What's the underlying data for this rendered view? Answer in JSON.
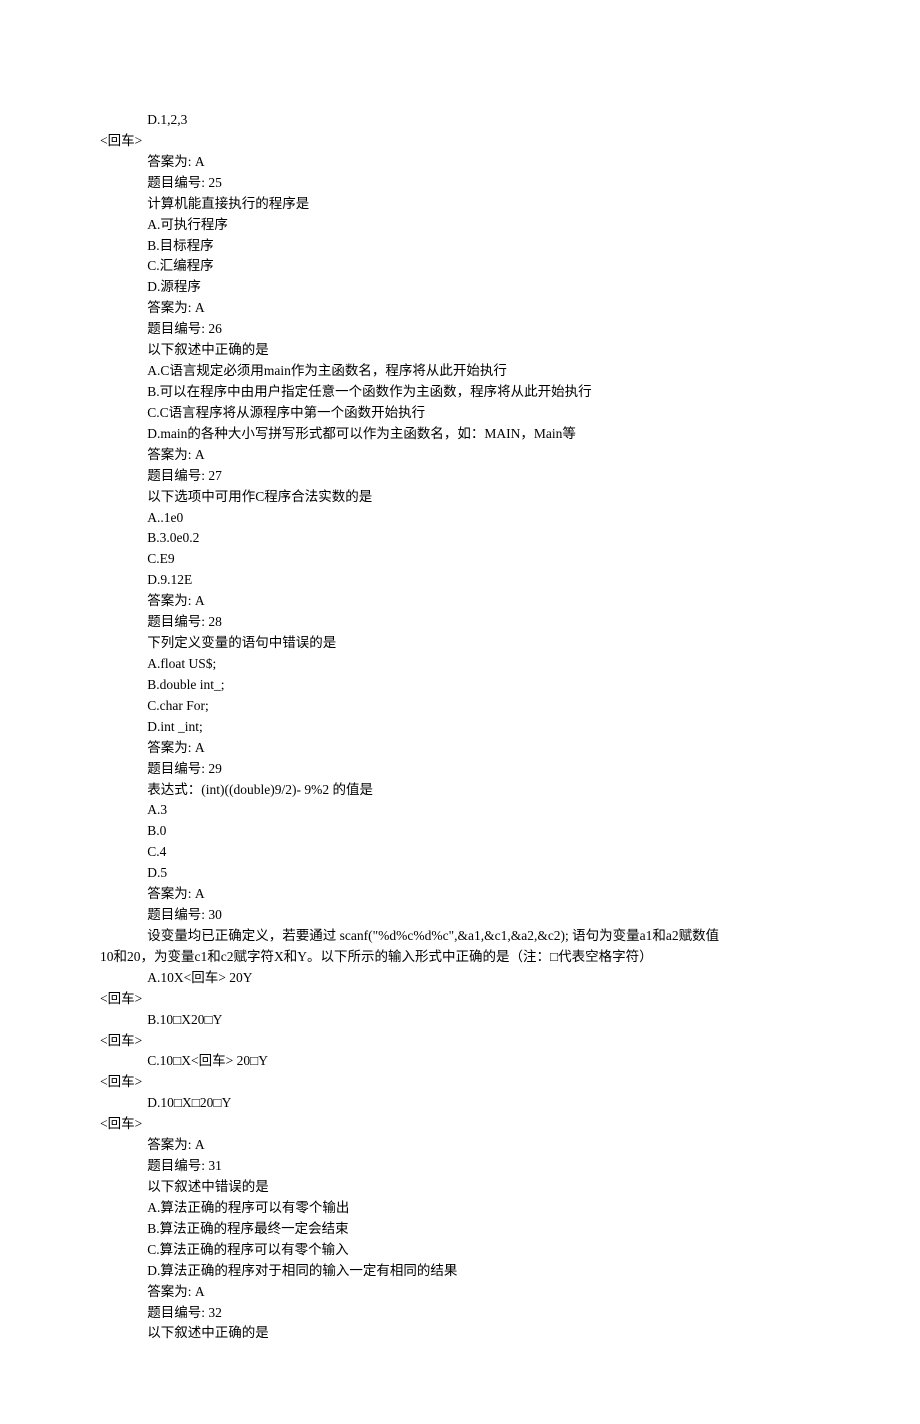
{
  "lines": [
    {
      "cls": "indent1",
      "text": "D.1,2,3"
    },
    {
      "cls": "flush",
      "text": "<回车>"
    },
    {
      "cls": "indent1",
      "text": "答案为: A"
    },
    {
      "cls": "indent1",
      "text": "题目编号: 25"
    },
    {
      "cls": "indent1",
      "text": "计算机能直接执行的程序是"
    },
    {
      "cls": "indent1",
      "text": "A.可执行程序"
    },
    {
      "cls": "indent1",
      "text": "B.目标程序"
    },
    {
      "cls": "indent1",
      "text": "C.汇编程序"
    },
    {
      "cls": "indent1",
      "text": "D.源程序"
    },
    {
      "cls": "indent1",
      "text": "答案为: A"
    },
    {
      "cls": "indent1",
      "text": "题目编号: 26"
    },
    {
      "cls": "indent1",
      "text": "以下叙述中正确的是"
    },
    {
      "cls": "indent1",
      "text": "A.C语言规定必须用main作为主函数名，程序将从此开始执行"
    },
    {
      "cls": "indent1",
      "text": "B.可以在程序中由用户指定任意一个函数作为主函数，程序将从此开始执行"
    },
    {
      "cls": "indent1",
      "text": "C.C语言程序将从源程序中第一个函数开始执行"
    },
    {
      "cls": "indent1",
      "text": "D.main的各种大小写拼写形式都可以作为主函数名，如：MAIN，Main等"
    },
    {
      "cls": "indent1",
      "text": "答案为: A"
    },
    {
      "cls": "indent1",
      "text": "题目编号: 27"
    },
    {
      "cls": "indent1",
      "text": "以下选项中可用作C程序合法实数的是"
    },
    {
      "cls": "indent1",
      "text": "A..1e0"
    },
    {
      "cls": "indent1",
      "text": "B.3.0e0.2"
    },
    {
      "cls": "indent1",
      "text": "C.E9"
    },
    {
      "cls": "indent1",
      "text": "D.9.12E"
    },
    {
      "cls": "indent1",
      "text": "答案为: A"
    },
    {
      "cls": "indent1",
      "text": "题目编号: 28"
    },
    {
      "cls": "indent1",
      "text": "下列定义变量的语句中错误的是"
    },
    {
      "cls": "indent1",
      "text": "A.float US$;"
    },
    {
      "cls": "indent1",
      "text": "B.double int_;"
    },
    {
      "cls": "indent1",
      "text": "C.char For;"
    },
    {
      "cls": "indent1",
      "text": "D.int _int;"
    },
    {
      "cls": "indent1",
      "text": "答案为: A"
    },
    {
      "cls": "indent1",
      "text": "题目编号: 29"
    },
    {
      "cls": "indent1",
      "text": "表达式：(int)((double)9/2)- 9%2 的值是"
    },
    {
      "cls": "indent1",
      "text": "A.3"
    },
    {
      "cls": "indent1",
      "text": "B.0"
    },
    {
      "cls": "indent1",
      "text": "C.4"
    },
    {
      "cls": "indent1",
      "text": "D.5"
    },
    {
      "cls": "indent1",
      "text": "答案为: A"
    },
    {
      "cls": "indent1",
      "text": "题目编号: 30"
    },
    {
      "cls": "indent1",
      "text": "设变量均已正确定义，若要通过 scanf(\"%d%c%d%c\",&a1,&c1,&a2,&c2); 语句为变量a1和a2赋数值"
    },
    {
      "cls": "flush",
      "text": "10和20，为变量c1和c2赋字符X和Y。以下所示的输入形式中正确的是（注：□代表空格字符）"
    },
    {
      "cls": "indent1",
      "text": "A.10X<回车> 20Y"
    },
    {
      "cls": "flush",
      "text": "<回车>"
    },
    {
      "cls": "indent1",
      "text": "B.10□X20□Y"
    },
    {
      "cls": "flush",
      "text": "<回车>"
    },
    {
      "cls": "indent1",
      "text": "C.10□X<回车> 20□Y"
    },
    {
      "cls": "flush",
      "text": "<回车>"
    },
    {
      "cls": "indent1",
      "text": "D.10□X□20□Y"
    },
    {
      "cls": "flush",
      "text": "<回车>"
    },
    {
      "cls": "indent1",
      "text": "答案为: A"
    },
    {
      "cls": "indent1",
      "text": "题目编号: 31"
    },
    {
      "cls": "indent1",
      "text": "以下叙述中错误的是"
    },
    {
      "cls": "indent1",
      "text": "A.算法正确的程序可以有零个输出"
    },
    {
      "cls": "indent1",
      "text": "B.算法正确的程序最终一定会结束"
    },
    {
      "cls": "indent1",
      "text": "C.算法正确的程序可以有零个输入"
    },
    {
      "cls": "indent1",
      "text": "D.算法正确的程序对于相同的输入一定有相同的结果"
    },
    {
      "cls": "indent1",
      "text": "答案为: A"
    },
    {
      "cls": "indent1",
      "text": "题目编号: 32"
    },
    {
      "cls": "indent1",
      "text": "以下叙述中正确的是"
    }
  ]
}
